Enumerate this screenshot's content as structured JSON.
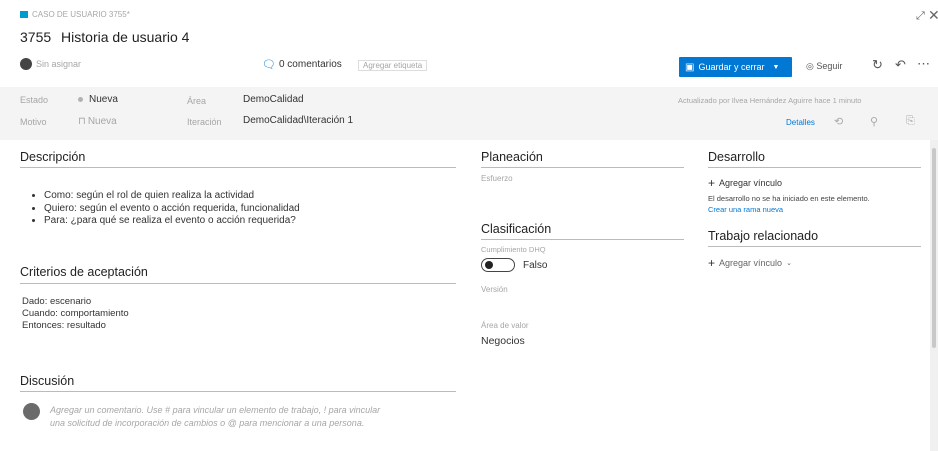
{
  "header": {
    "type_label": "CASO DE USUARIO 3755*",
    "id": "3755",
    "title": "Historia de usuario 4",
    "assignee": "Sin asignar",
    "comments": "0 comentarios",
    "tag_placeholder": "Agregar etiqueta",
    "save_button": "Guardar y cerrar",
    "follow_button": "Seguir"
  },
  "fields": {
    "state_label": "Estado",
    "state_value": "Nueva",
    "reason_label": "Motivo",
    "reason_value": "Nueva",
    "area_label": "Área",
    "area_value": "DemoCalidad",
    "iteration_label": "Iteración",
    "iteration_value": "DemoCalidad\\Iteración 1",
    "updated_text": "Actualizado por Ilvea Hernández Aguirre hace 1 minuto",
    "details_tab": "Detalles",
    "state_color": "#b2b2b2"
  },
  "description": {
    "title": "Descripción",
    "items": [
      "Como: según el rol de quien realiza la actividad",
      "Quiero: según el evento o acción requerida, funcionalidad",
      "Para: ¿para qué se realiza el evento o acción requerida?"
    ]
  },
  "acceptance": {
    "title": "Criterios de aceptación",
    "lines": [
      "Dado: escenario",
      "Cuando: comportamiento",
      "Entonces: resultado"
    ]
  },
  "discussion": {
    "title": "Discusión",
    "placeholder_line1": "Agregar un comentario. Use # para vincular un elemento de trabajo, ! para vincular",
    "placeholder_line2": "una solicitud de incorporación de cambios o @ para mencionar a una persona."
  },
  "planning": {
    "title": "Planeación",
    "effort_label": "Esfuerzo"
  },
  "classification": {
    "title": "Clasificación",
    "toggle_label": "Cumplimiento DHQ",
    "toggle_value": "Falso",
    "release_label": "Versión",
    "value_area_label": "Área de valor",
    "value_area_value": "Negocios"
  },
  "development": {
    "title": "Desarrollo",
    "add_link": "Agregar vínculo",
    "info": "El desarrollo no se ha iniciado en este elemento.",
    "create_branch": "Crear una rama nueva"
  },
  "related": {
    "title": "Trabajo relacionado",
    "add_link": "Agregar vínculo"
  },
  "colors": {
    "accent": "#0078d4",
    "badge": "#009ccc"
  }
}
